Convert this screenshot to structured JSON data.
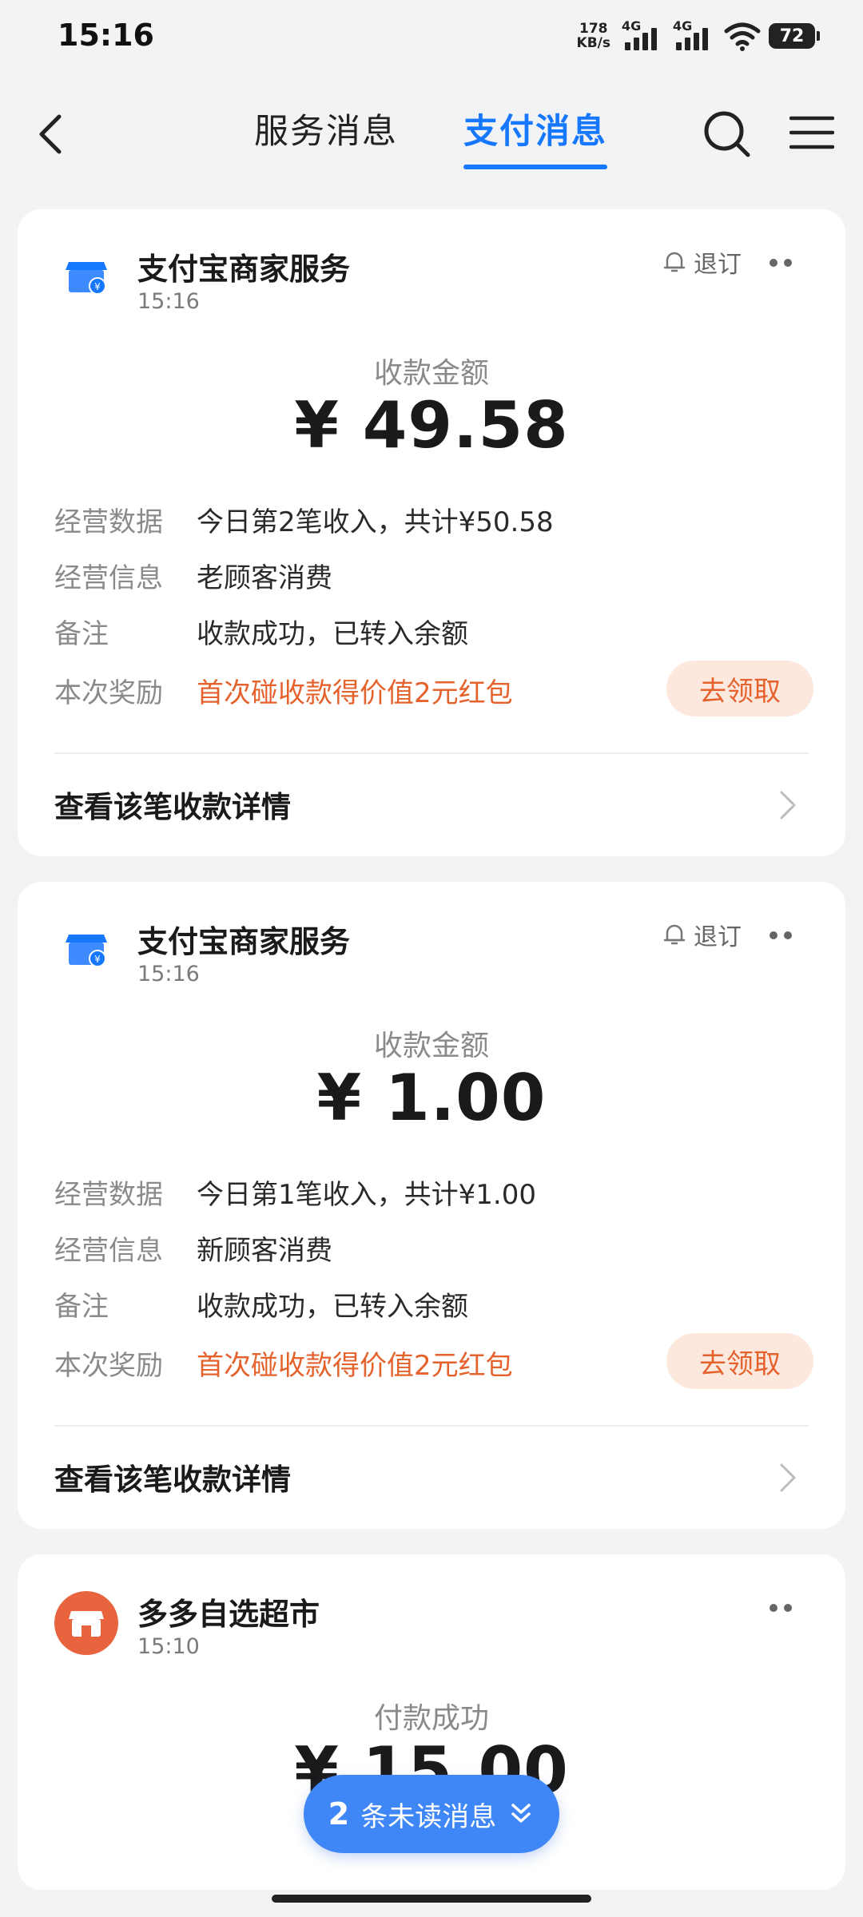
{
  "status_bar": {
    "time": "15:16",
    "speed_value": "178",
    "speed_unit": "KB/s",
    "net1": "4G",
    "net2": "4G",
    "battery": "72"
  },
  "nav": {
    "tabs": [
      {
        "label": "服务消息",
        "active": false
      },
      {
        "label": "支付消息",
        "active": true
      }
    ],
    "accent_color": "#1677ff"
  },
  "cards": [
    {
      "title": "支付宝商家服务",
      "time": "15:16",
      "unsubscribe": "退订",
      "amount_label": "收款金额",
      "amount": "¥ 49.58",
      "rows": [
        {
          "key": "经营数据",
          "value": "今日第2笔收入，共计¥50.58"
        },
        {
          "key": "经营信息",
          "value": "老顾客消费"
        },
        {
          "key": "备注",
          "value": "收款成功，已转入余额"
        },
        {
          "key": "本次奖励",
          "value": "首次碰收款得价值2元红包"
        }
      ],
      "claim_button": "去领取",
      "detail_link": "查看该笔收款详情"
    },
    {
      "title": "支付宝商家服务",
      "time": "15:16",
      "unsubscribe": "退订",
      "amount_label": "收款金额",
      "amount": "¥ 1.00",
      "rows": [
        {
          "key": "经营数据",
          "value": "今日第1笔收入，共计¥1.00"
        },
        {
          "key": "经营信息",
          "value": "新顾客消费"
        },
        {
          "key": "备注",
          "value": "收款成功，已转入余额"
        },
        {
          "key": "本次奖励",
          "value": "首次碰收款得价值2元红包"
        }
      ],
      "claim_button": "去领取",
      "detail_link": "查看该笔收款详情"
    },
    {
      "title": "多多自选超市",
      "time": "15:10",
      "amount_label": "付款成功",
      "amount": "¥ 15.00"
    }
  ],
  "unread_pill": {
    "count": "2",
    "label": "条未读消息"
  },
  "colors": {
    "reward_text": "#e5622d",
    "claim_bg": "#fde8de",
    "unread_bg": "#3f86f6"
  }
}
